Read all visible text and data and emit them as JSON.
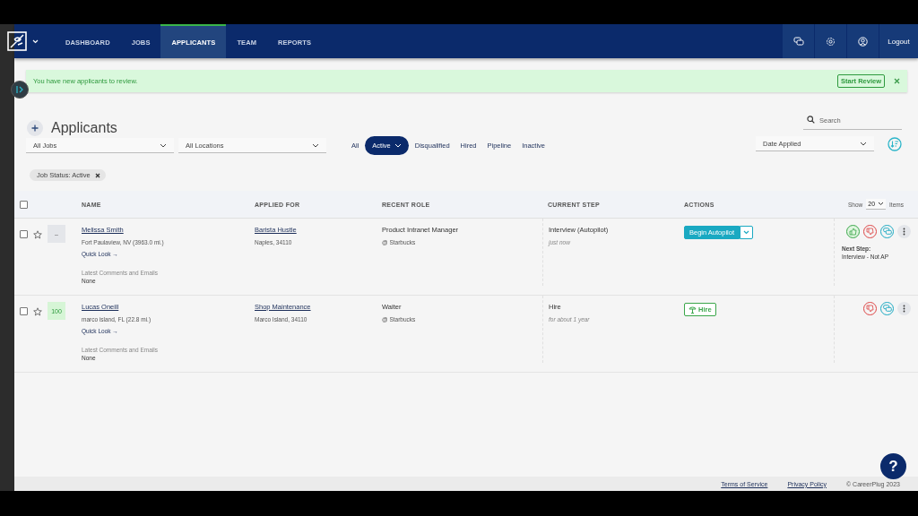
{
  "nav": {
    "items": [
      {
        "label": "DASHBOARD",
        "selected": false
      },
      {
        "label": "JOBS",
        "selected": false
      },
      {
        "label": "APPLICANTS",
        "selected": true
      },
      {
        "label": "TEAM",
        "selected": false
      },
      {
        "label": "REPORTS",
        "selected": false
      }
    ],
    "logout": "Logout"
  },
  "alert": {
    "message": "You have new applicants to review.",
    "button": "Start Review"
  },
  "page": {
    "title": "Applicants",
    "search_placeholder": "Search",
    "jobs_filter": "All Jobs",
    "locations_filter": "All Locations",
    "sort": "Date Applied",
    "chip": "Job Status: Active"
  },
  "status_tabs": [
    {
      "label": "All",
      "selected": false
    },
    {
      "label": "Active",
      "selected": true
    },
    {
      "label": "Disqualified",
      "selected": false
    },
    {
      "label": "Hired",
      "selected": false
    },
    {
      "label": "Pipeline",
      "selected": false
    },
    {
      "label": "Inactive",
      "selected": false
    }
  ],
  "table": {
    "select_all_checked": false,
    "columns": [
      "NAME",
      "APPLIED FOR",
      "RECENT ROLE",
      "CURRENT STEP",
      "ACTIONS"
    ],
    "show_label": "Show",
    "per_page": "20",
    "items_label": "Items",
    "rows": [
      {
        "checked": false,
        "starred": false,
        "score": "–",
        "color": "#e4e6ea",
        "name": "Melissa Smith",
        "location": "Fort Paulaview, NV (3963.0 mi.)",
        "quick_look": "Quick Look →",
        "comments_label": "Latest Comments and Emails",
        "comments": "None",
        "job": "Barista Hustle",
        "job_location": "Naples, 34110",
        "role": "Product Intranet Manager",
        "employer": "@ Starbucks",
        "step": "Interview (Autopilot)",
        "step_time": "just now",
        "action": {
          "kind": "autopilot",
          "label": "Begin Autopilot"
        },
        "approve": true,
        "next_step_label": "Next Step:",
        "next_step": "Interview - Not AP"
      },
      {
        "checked": false,
        "starred": false,
        "score": "100",
        "color": "#d6f5d6",
        "name": "Lucas Oneill",
        "location": "marco island, FL (22.8 mi.)",
        "quick_look": "Quick Look →",
        "comments_label": "Latest Comments and Emails",
        "comments": "None",
        "job": "Shop Maintenance",
        "job_location": "Marco Island, 34110",
        "role": "Waiter",
        "employer": "@ Starbucks",
        "step": "Hire",
        "step_time": "for about 1 year",
        "action": {
          "kind": "hire",
          "label": "Hire"
        },
        "approve": false
      }
    ]
  },
  "footer": {
    "links": [
      "Terms of Service",
      "Privacy Policy"
    ],
    "copyright": "© CareerPlug 2023"
  },
  "help": "?"
}
